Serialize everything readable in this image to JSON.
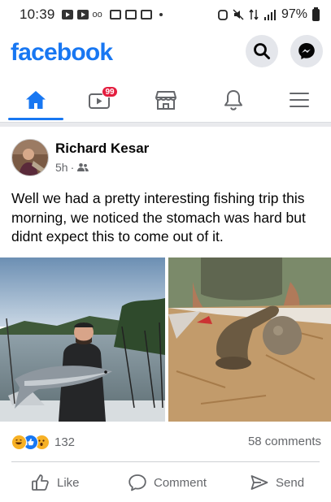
{
  "status_bar": {
    "time": "10:39",
    "battery": "97%"
  },
  "header": {
    "logo": "facebook",
    "icons": [
      "search-icon",
      "messenger-icon"
    ]
  },
  "nav": {
    "tabs": [
      {
        "name": "home",
        "icon": "home-icon",
        "active": true
      },
      {
        "name": "watch",
        "icon": "video-icon",
        "badge": "99"
      },
      {
        "name": "marketplace",
        "icon": "marketplace-icon"
      },
      {
        "name": "notifications",
        "icon": "bell-icon"
      },
      {
        "name": "menu",
        "icon": "hamburger-menu-icon"
      }
    ]
  },
  "post": {
    "author": "Richard Kesar",
    "time": "5h",
    "separator": "·",
    "privacy_icon": "friends-icon",
    "text": "Well we had a pretty interesting fishing trip this morning,  we noticed the stomach was hard but didnt expect this to come out of it.",
    "reaction_count": "132",
    "comments": "58 comments",
    "actions": {
      "like": "Like",
      "comment": "Comment",
      "send": "Send"
    }
  },
  "colors": {
    "brand": "#1877f2",
    "badge": "#e41e3f",
    "secondary_text": "#65676b"
  }
}
